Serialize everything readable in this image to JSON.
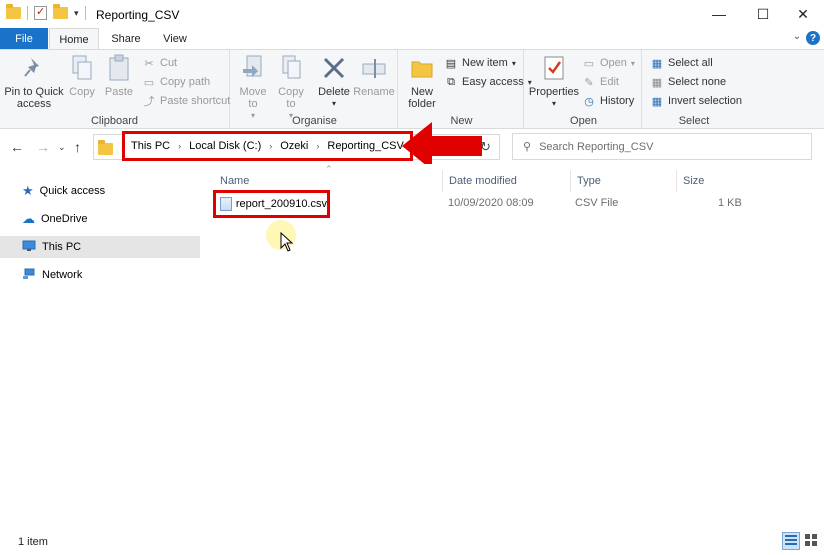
{
  "window": {
    "title": "Reporting_CSV",
    "minimize": "—",
    "maximize": "☐",
    "close": "✕"
  },
  "tabs": {
    "file": "File",
    "home": "Home",
    "share": "Share",
    "view": "View",
    "collapse": "⌄",
    "help": "?"
  },
  "ribbon": {
    "clipboard": {
      "label": "Clipboard",
      "pin": "Pin to Quick access",
      "copy": "Copy",
      "paste": "Paste",
      "cut": "Cut",
      "copy_path": "Copy path",
      "paste_shortcut": "Paste shortcut"
    },
    "organise": {
      "label": "Organise",
      "move_to": "Move to",
      "copy_to": "Copy to",
      "delete": "Delete",
      "rename": "Rename"
    },
    "new": {
      "label": "New",
      "new_folder": "New folder",
      "new_item": "New item",
      "easy_access": "Easy access"
    },
    "open": {
      "label": "Open",
      "properties": "Properties",
      "open": "Open",
      "edit": "Edit",
      "history": "History"
    },
    "select": {
      "label": "Select",
      "select_all": "Select all",
      "select_none": "Select none",
      "invert_selection": "Invert selection"
    }
  },
  "address": {
    "crumbs": [
      "This PC",
      "Local Disk (C:)",
      "Ozeki",
      "Reporting_CSV"
    ],
    "search_placeholder": "Search Reporting_CSV"
  },
  "nav": {
    "items": [
      {
        "label": "Quick access",
        "icon": "star-icon"
      },
      {
        "label": "OneDrive",
        "icon": "cloud-icon"
      },
      {
        "label": "This PC",
        "icon": "computer-icon",
        "selected": true
      },
      {
        "label": "Network",
        "icon": "network-icon"
      }
    ]
  },
  "columns": {
    "name": "Name",
    "date_modified": "Date modified",
    "type": "Type",
    "size": "Size"
  },
  "files": [
    {
      "name": "report_200910.csv",
      "date_modified": "10/09/2020 08:09",
      "type": "CSV File",
      "size": "1 KB"
    }
  ],
  "status": {
    "item_count": "1 item"
  },
  "colors": {
    "accent": "#1a73c8",
    "highlight_red": "#e00000"
  }
}
